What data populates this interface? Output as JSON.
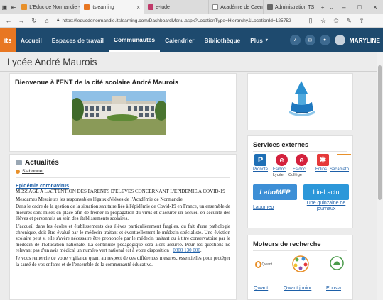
{
  "browser": {
    "tabs": [
      {
        "label": "L'Educ de Normandie -",
        "color": "#e8902a"
      },
      {
        "label": "itslearning",
        "color": "#e87722"
      },
      {
        "label": "e-tude",
        "color": "#c03a6a"
      },
      {
        "label": "Académie de Caen",
        "color": "#9a9a9a"
      },
      {
        "label": "Administration TS",
        "color": "#6a6a6a"
      }
    ],
    "url": "https://leducdenormandie.itslearning.com/DashboardMenu.aspx?LocationType=Hierarchy&LocationId=125752"
  },
  "nav": {
    "logo": "its",
    "items": [
      "Accueil",
      "Espaces de travail",
      "Communautés",
      "Calendrier",
      "Bibliothèque",
      "Plus"
    ],
    "active_index": 2,
    "user": "MARYLINE"
  },
  "page": {
    "title": "Lycée André Maurois",
    "welcome_heading": "Bienvenue à l'ENT de la cité scolaire André Maurois"
  },
  "news": {
    "title": "Actualités",
    "subscribe": "S'abonner",
    "article_title": "Epidémie coronavirus",
    "paragraphs": [
      "MESSAGE A L'ATTENTION DES PARENTS D'ELEVES CONCERNANT L'EPIDEMIE A COVID-19",
      "Mesdames Messieurs les responsables légaux d'élèves de l'Académie de Normandie",
      "Dans le cadre de la gestion de la situation sanitaire liée à l'épidémie de Covid-19 en France, un ensemble de mesures sont mises en place afin de freiner la propagation du virus et d'assurer un accueil en sécurité des élèves et personnels au sein des établissements scolaires.",
      "L'accueil dans les écoles et établissements des élèves particulièrement fragiles, du fait d'une pathologie chronique, doit être évalué par le médecin traitant et éventuellement le médecin spécialiste. Une éviction scolaire peut si elle s'avère nécessaire être prononcée par le médecin traitant ou à titre conservatoire par le médecin de l'Education nationale. La continuité pédagogique sera alors assurée. Pour les questions ne relevant pas d'un avis médical un numéro vert national est à votre disposition :",
      "Je vous remercie de votre vigilance quant au respect de ces différentes mesures, essentielles pour protéger la santé de vos enfants et de l'ensemble de la communauté éducative."
    ],
    "phone": "0800 130 000",
    "phone_suffix": "."
  },
  "services": {
    "title": "Services externes",
    "icons": [
      {
        "label": "Pronote",
        "color": "#1f6fb5",
        "glyph": "P"
      },
      {
        "label": "Esidoc",
        "sub": "Lycée",
        "color": "#d4213d",
        "glyph": "e"
      },
      {
        "label": "Esidoc",
        "sub": "Collège",
        "color": "#d4213d",
        "glyph": "e"
      },
      {
        "label": "Folios",
        "color": "#e63a3a",
        "glyph": "✱"
      },
      {
        "label": "Secamath",
        "color": "#e8902a",
        "glyph": ""
      }
    ],
    "boxes": [
      {
        "text": "LaboMEP",
        "label": "Labomep",
        "color": "#3d8fd6"
      },
      {
        "text": "LireLactu",
        "label": "Une quinzaine de journaux",
        "color": "#2c97d9"
      }
    ]
  },
  "search": {
    "title": "Moteurs de recherche",
    "engines": [
      {
        "name": "Qwant",
        "color": "#e8902a"
      },
      {
        "name": "Qwant junior",
        "color": "#5ab04a"
      },
      {
        "name": "Ecosia",
        "color": "#4a9a4a"
      }
    ]
  }
}
